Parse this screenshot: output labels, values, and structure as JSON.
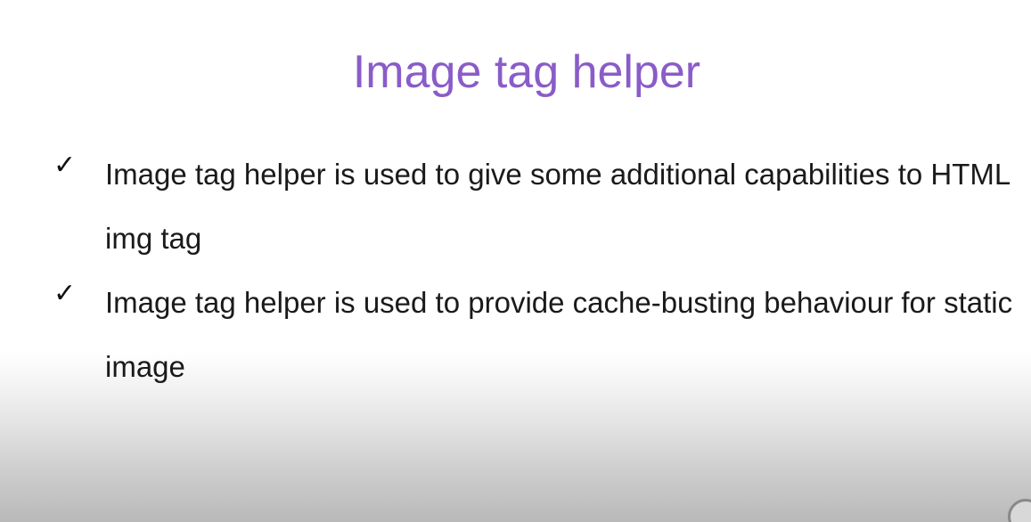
{
  "slide": {
    "title": "Image tag helper",
    "title_color": "#8a5cc8",
    "bullets": [
      {
        "icon": "checkmark-icon",
        "text": "Image tag helper is used to give some additional capabilities to HTML img tag"
      },
      {
        "icon": "checkmark-icon",
        "text": "Image tag helper is used to provide cache-busting behaviour for static image"
      }
    ]
  }
}
